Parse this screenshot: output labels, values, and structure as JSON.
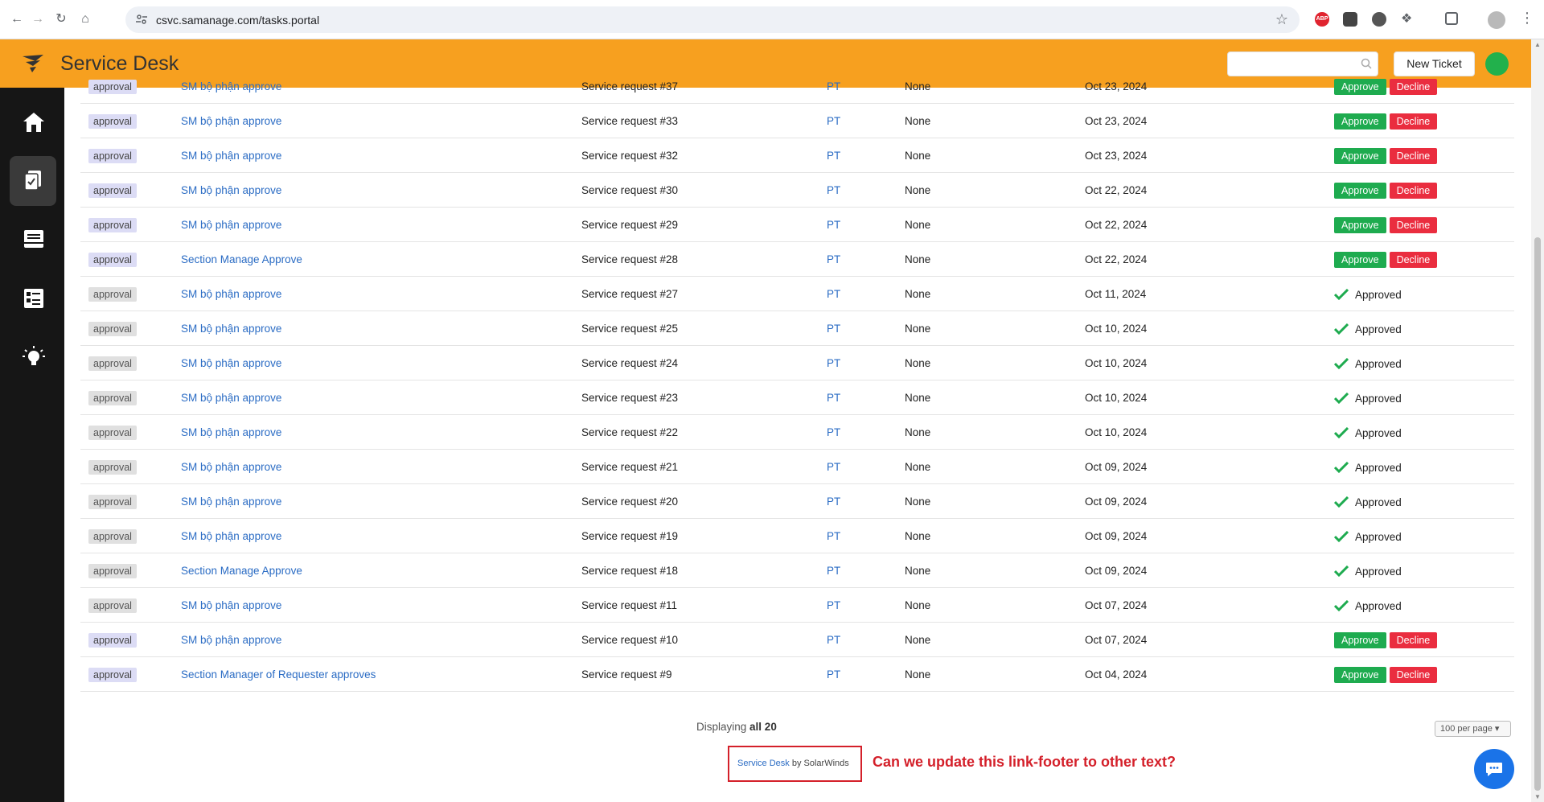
{
  "browser": {
    "url": "csvc.samanage.com/tasks.portal",
    "abp_label": "ABP"
  },
  "header": {
    "title": "Service Desk",
    "search_placeholder": "",
    "new_ticket_label": "New Ticket"
  },
  "rows": [
    {
      "tag": "approval",
      "name": "SM bộ phận approve",
      "request": "Service request #37",
      "pt": "PT",
      "none": "None",
      "date": "Oct 23, 2024",
      "approve": "Approve",
      "decline": "Decline"
    },
    {
      "tag": "approval",
      "name": "SM bộ phận approve",
      "request": "Service request #33",
      "pt": "PT",
      "none": "None",
      "date": "Oct 23, 2024",
      "approve": "Approve",
      "decline": "Decline"
    },
    {
      "tag": "approval",
      "name": "SM bộ phận approve",
      "request": "Service request #32",
      "pt": "PT",
      "none": "None",
      "date": "Oct 23, 2024",
      "approve": "Approve",
      "decline": "Decline"
    },
    {
      "tag": "approval",
      "name": "SM bộ phận approve",
      "request": "Service request #30",
      "pt": "PT",
      "none": "None",
      "date": "Oct 22, 2024",
      "approve": "Approve",
      "decline": "Decline"
    },
    {
      "tag": "approval",
      "name": "SM bộ phận approve",
      "request": "Service request #29",
      "pt": "PT",
      "none": "None",
      "date": "Oct 22, 2024",
      "approve": "Approve",
      "decline": "Decline"
    },
    {
      "tag": "approval",
      "name": "Section Manage Approve",
      "request": "Service request #28",
      "pt": "PT",
      "none": "None",
      "date": "Oct 22, 2024",
      "approve": "Approve",
      "decline": "Decline"
    },
    {
      "tag": "approval",
      "name": "SM bộ phận approve",
      "request": "Service request #27",
      "pt": "PT",
      "none": "None",
      "date": "Oct 11, 2024",
      "approved": "Approved"
    },
    {
      "tag": "approval",
      "name": "SM bộ phận approve",
      "request": "Service request #25",
      "pt": "PT",
      "none": "None",
      "date": "Oct 10, 2024",
      "approved": "Approved"
    },
    {
      "tag": "approval",
      "name": "SM bộ phận approve",
      "request": "Service request #24",
      "pt": "PT",
      "none": "None",
      "date": "Oct 10, 2024",
      "approved": "Approved"
    },
    {
      "tag": "approval",
      "name": "SM bộ phận approve",
      "request": "Service request #23",
      "pt": "PT",
      "none": "None",
      "date": "Oct 10, 2024",
      "approved": "Approved"
    },
    {
      "tag": "approval",
      "name": "SM bộ phận approve",
      "request": "Service request #22",
      "pt": "PT",
      "none": "None",
      "date": "Oct 10, 2024",
      "approved": "Approved"
    },
    {
      "tag": "approval",
      "name": "SM bộ phận approve",
      "request": "Service request #21",
      "pt": "PT",
      "none": "None",
      "date": "Oct 09, 2024",
      "approved": "Approved"
    },
    {
      "tag": "approval",
      "name": "SM bộ phận approve",
      "request": "Service request #20",
      "pt": "PT",
      "none": "None",
      "date": "Oct 09, 2024",
      "approved": "Approved"
    },
    {
      "tag": "approval",
      "name": "SM bộ phận approve",
      "request": "Service request #19",
      "pt": "PT",
      "none": "None",
      "date": "Oct 09, 2024",
      "approved": "Approved"
    },
    {
      "tag": "approval",
      "name": "Section Manage Approve",
      "request": "Service request #18",
      "pt": "PT",
      "none": "None",
      "date": "Oct 09, 2024",
      "approved": "Approved"
    },
    {
      "tag": "approval",
      "name": "SM bộ phận approve",
      "request": "Service request #11",
      "pt": "PT",
      "none": "None",
      "date": "Oct 07, 2024",
      "approved": "Approved"
    },
    {
      "tag": "approval",
      "name": "SM bộ phận approve",
      "request": "Service request #10",
      "pt": "PT",
      "none": "None",
      "date": "Oct 07, 2024",
      "approve": "Approve",
      "decline": "Decline"
    },
    {
      "tag": "approval",
      "name": "Section Manager of Requester approves",
      "request": "Service request #9",
      "pt": "PT",
      "none": "None",
      "date": "Oct 04, 2024",
      "approve": "Approve",
      "decline": "Decline"
    }
  ],
  "pagination": {
    "prefix": "Displaying",
    "count": "all 20",
    "per_page": "100 per page"
  },
  "footer": {
    "link_text": "Service Desk",
    "suffix": "by SolarWinds"
  },
  "annotation": "Can we update this link-footer to other text?",
  "colors": {
    "header": "#f7a01f",
    "approve": "#1eab4f",
    "decline": "#ea2d3f",
    "link": "#2b6cc4",
    "annotation": "#d4202a"
  },
  "icons": {
    "sidebar": [
      "home-icon",
      "tasks-icon",
      "inbox-icon",
      "catalog-icon",
      "lightbulb-icon"
    ]
  }
}
